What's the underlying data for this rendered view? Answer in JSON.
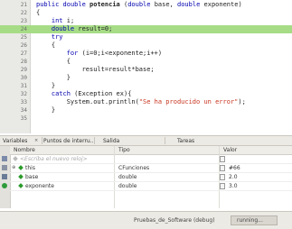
{
  "editor": {
    "lines": [
      {
        "num": "21",
        "text": "public double potencia (double base, double exponente)"
      },
      {
        "num": "22",
        "text": "{"
      },
      {
        "num": "23",
        "text": "    int i;"
      },
      {
        "num": "24",
        "text": "    double result=0;"
      },
      {
        "num": "25",
        "text": "    try"
      },
      {
        "num": "26",
        "text": "    {"
      },
      {
        "num": "27",
        "text": "        for (i=0;i<exponente;i++)"
      },
      {
        "num": "28",
        "text": "        {"
      },
      {
        "num": "29",
        "text": "            result=result*base;"
      },
      {
        "num": "30",
        "text": "        }"
      },
      {
        "num": "31",
        "text": "    }"
      },
      {
        "num": "32",
        "text": "    catch (Exception ex){"
      },
      {
        "num": "33",
        "text": "        System.out.println(\"Se ha producido un error\");"
      },
      {
        "num": "34",
        "text": "    }"
      },
      {
        "num": "35",
        "text": "    "
      }
    ],
    "highlight_color": "#a6dc86"
  },
  "panel_tabs": [
    "Variables",
    "Puntos de interru...",
    "Salida",
    "Tareas"
  ],
  "variables": {
    "columns": [
      "Nombre",
      "Tipo",
      "Valor"
    ],
    "new_watch_placeholder": "<Escriba el nuevo reloj>",
    "rows": [
      {
        "name": "this",
        "type": "CFunciones",
        "value": "#66"
      },
      {
        "name": "base",
        "type": "double",
        "value": "2.0"
      },
      {
        "name": "exponente",
        "type": "double",
        "value": "3.0"
      }
    ]
  },
  "status": {
    "project": "Pruebas_de_Software (debug)",
    "state": "running..."
  }
}
